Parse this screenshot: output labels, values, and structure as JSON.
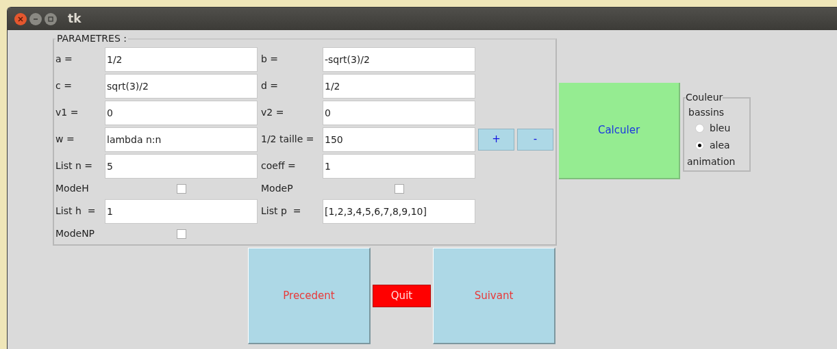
{
  "window": {
    "title": "tk"
  },
  "params": {
    "legend": "PARAMETRES :",
    "rows": [
      {
        "kind": "fields",
        "left": {
          "label": "a =",
          "value": "1/2"
        },
        "right": {
          "label": "b =",
          "value": "-sqrt(3)/2"
        }
      },
      {
        "kind": "fields",
        "left": {
          "label": "c =",
          "value": "sqrt(3)/2"
        },
        "right": {
          "label": "d =",
          "value": "1/2"
        }
      },
      {
        "kind": "fields",
        "left": {
          "label": "v1 =",
          "value": "0"
        },
        "right": {
          "label": "v2 =",
          "value": "0"
        }
      },
      {
        "kind": "fields",
        "left": {
          "label": "w =",
          "value": "lambda n:n"
        },
        "right": {
          "label": "1/2 taille =",
          "value": "150"
        },
        "buttons": [
          "+",
          "-"
        ]
      },
      {
        "kind": "fields",
        "left": {
          "label": "List n =",
          "value": "5"
        },
        "right": {
          "label": "coeff =",
          "value": "1"
        }
      },
      {
        "kind": "checks",
        "left": {
          "label": "ModeH",
          "checked": false
        },
        "right": {
          "label": "ModeP",
          "checked": false
        }
      },
      {
        "kind": "fields",
        "left": {
          "label": "List h  =",
          "value": "1"
        },
        "right": {
          "label": "List p  =",
          "value": "[1,2,3,4,5,6,7,8,9,10]"
        }
      },
      {
        "kind": "checks",
        "left": {
          "label": "ModeNP",
          "checked": false
        }
      }
    ]
  },
  "calculate": "Calculer",
  "color_group": {
    "legend": "Couleur",
    "caption": "bassins",
    "options": [
      {
        "label": "bleu",
        "selected": false
      },
      {
        "label": "alea",
        "selected": true
      }
    ],
    "footer": "animation"
  },
  "nav": {
    "previous": "Precedent",
    "quit": "Quit",
    "next": "Suivant"
  }
}
